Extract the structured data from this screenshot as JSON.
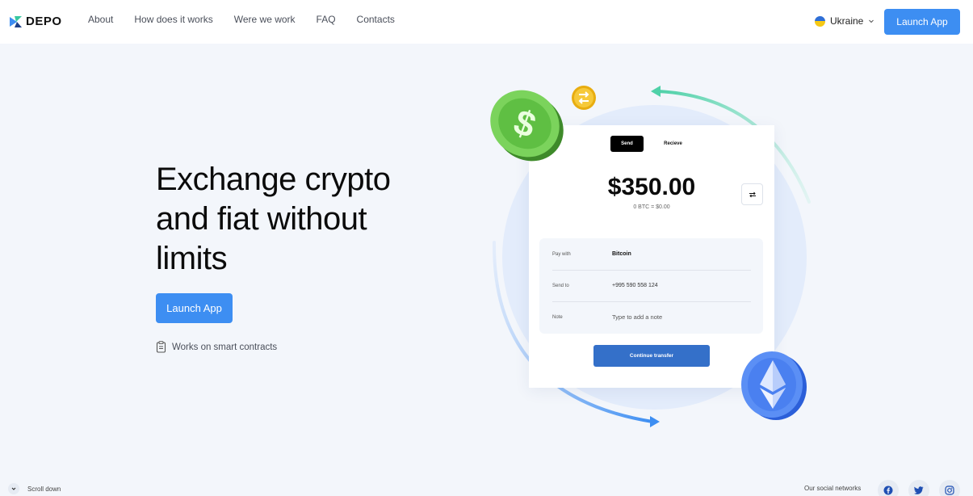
{
  "header": {
    "brand": "DEPO",
    "nav": [
      "About",
      "How does it works",
      "Were we work",
      "FAQ",
      "Contacts"
    ],
    "language": "Ukraine",
    "launch_label": "Launch App"
  },
  "hero": {
    "title_lines": [
      "Exchange crypto",
      "and fiat without",
      "limits"
    ],
    "launch_label": "Launch App",
    "smart_contracts": "Works on smart contracts"
  },
  "widget": {
    "tab_send": "Send",
    "tab_receive": "Recieve",
    "amount": "$350.00",
    "amount_sub": "0 BTC = $0.00",
    "pay_with_label": "Pay with",
    "pay_with_value": "Bitcoin",
    "send_to_label": "Send to",
    "send_to_value": "+995 590 558 124",
    "note_label": "Note",
    "note_placeholder": "Type to add a note",
    "continue_label": "Continue transfer"
  },
  "footer": {
    "scroll_label": "Scroll down",
    "social_label": "Our social networks",
    "socials": [
      "facebook-icon",
      "twitter-icon",
      "instagram-icon"
    ]
  },
  "colors": {
    "accent": "#3d8ef2",
    "continue": "#3470c9",
    "background": "#f3f6fb"
  }
}
